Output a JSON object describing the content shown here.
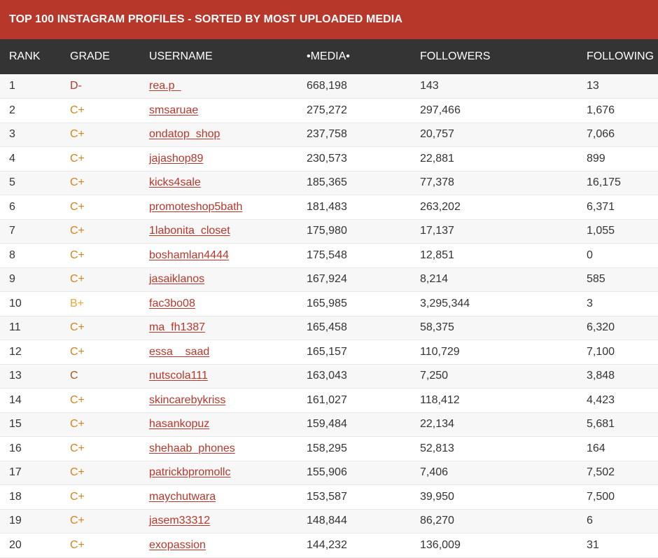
{
  "title": "TOP 100 INSTAGRAM PROFILES - SORTED BY MOST UPLOADED MEDIA",
  "headers": {
    "rank": "RANK",
    "grade": "GRADE",
    "username": "USERNAME",
    "media": "•MEDIA•",
    "followers": "FOLLOWERS",
    "following": "FOLLOWING"
  },
  "colors": {
    "title_bar": "#b7372b",
    "header_bar": "#343434",
    "link": "#b7372b",
    "grade_d": "#b7372b",
    "grade_c_plus": "#d3841c",
    "grade_b_plus": "#e6a93a",
    "grade_c": "#a05a1c"
  },
  "rows": [
    {
      "rank": "1",
      "grade": "D-",
      "grade_color": "red",
      "username": "rea.p_",
      "media": "668,198",
      "followers": "143",
      "following": "13"
    },
    {
      "rank": "2",
      "grade": "C+",
      "grade_color": "orange",
      "username": "smsaruae",
      "media": "275,272",
      "followers": "297,466",
      "following": "1,676"
    },
    {
      "rank": "3",
      "grade": "C+",
      "grade_color": "orange",
      "username": "ondatop_shop",
      "media": "237,758",
      "followers": "20,757",
      "following": "7,066"
    },
    {
      "rank": "4",
      "grade": "C+",
      "grade_color": "orange",
      "username": "jajashop89",
      "media": "230,573",
      "followers": "22,881",
      "following": "899"
    },
    {
      "rank": "5",
      "grade": "C+",
      "grade_color": "orange",
      "username": "kicks4sale",
      "media": "185,365",
      "followers": "77,378",
      "following": "16,175"
    },
    {
      "rank": "6",
      "grade": "C+",
      "grade_color": "orange",
      "username": "promoteshop5bath",
      "media": "181,483",
      "followers": "263,202",
      "following": "6,371"
    },
    {
      "rank": "7",
      "grade": "C+",
      "grade_color": "orange",
      "username": "1labonita_closet",
      "media": "175,980",
      "followers": "17,137",
      "following": "1,055"
    },
    {
      "rank": "8",
      "grade": "C+",
      "grade_color": "orange",
      "username": "boshamlan4444",
      "media": "175,548",
      "followers": "12,851",
      "following": "0"
    },
    {
      "rank": "9",
      "grade": "C+",
      "grade_color": "orange",
      "username": "jasaiklanos",
      "media": "167,924",
      "followers": "8,214",
      "following": "585"
    },
    {
      "rank": "10",
      "grade": "B+",
      "grade_color": "yellow",
      "username": "fac3bo08",
      "media": "165,985",
      "followers": "3,295,344",
      "following": "3"
    },
    {
      "rank": "11",
      "grade": "C+",
      "grade_color": "orange",
      "username": "ma_fh1387",
      "media": "165,458",
      "followers": "58,375",
      "following": "6,320"
    },
    {
      "rank": "12",
      "grade": "C+",
      "grade_color": "orange",
      "username": "essa__saad",
      "media": "165,157",
      "followers": "110,729",
      "following": "7,100"
    },
    {
      "rank": "13",
      "grade": "C",
      "grade_color": "brown",
      "username": "nutscola111",
      "media": "163,043",
      "followers": "7,250",
      "following": "3,848"
    },
    {
      "rank": "14",
      "grade": "C+",
      "grade_color": "orange",
      "username": "skincarebykriss",
      "media": "161,027",
      "followers": "118,412",
      "following": "4,423"
    },
    {
      "rank": "15",
      "grade": "C+",
      "grade_color": "orange",
      "username": "hasankopuz",
      "media": "159,484",
      "followers": "22,134",
      "following": "5,681"
    },
    {
      "rank": "16",
      "grade": "C+",
      "grade_color": "orange",
      "username": "shehaab_phones",
      "media": "158,295",
      "followers": "52,813",
      "following": "164"
    },
    {
      "rank": "17",
      "grade": "C+",
      "grade_color": "orange",
      "username": "patrickbpromollc",
      "media": "155,906",
      "followers": "7,406",
      "following": "7,502"
    },
    {
      "rank": "18",
      "grade": "C+",
      "grade_color": "orange",
      "username": "maychutwara",
      "media": "153,587",
      "followers": "39,950",
      "following": "7,500"
    },
    {
      "rank": "19",
      "grade": "C+",
      "grade_color": "orange",
      "username": "jasem33312",
      "media": "148,844",
      "followers": "86,270",
      "following": "6"
    },
    {
      "rank": "20",
      "grade": "C+",
      "grade_color": "orange",
      "username": "exopassion",
      "media": "144,232",
      "followers": "136,009",
      "following": "31"
    }
  ]
}
